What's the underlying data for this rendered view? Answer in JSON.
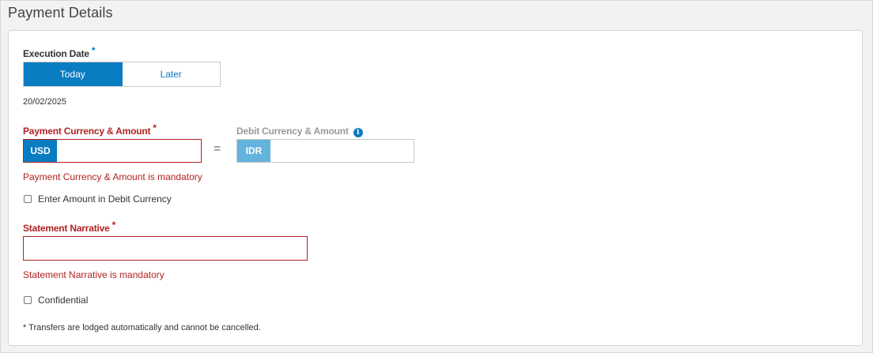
{
  "section": {
    "title": "Payment Details"
  },
  "execution_date": {
    "label": "Execution Date",
    "required_mark": "*",
    "options": [
      "Today",
      "Later"
    ],
    "selected": "Today",
    "date_value": "20/02/2025"
  },
  "payment_amount": {
    "label": "Payment Currency & Amount",
    "required_mark": "*",
    "currency": "USD",
    "value": "",
    "error": "Payment Currency & Amount is mandatory"
  },
  "equals_sign": "=",
  "debit_amount": {
    "label": "Debit Currency & Amount",
    "info_icon": "i",
    "currency": "IDR",
    "value": ""
  },
  "debit_currency_checkbox": {
    "label": "Enter Amount in Debit Currency",
    "checked": false
  },
  "statement_narrative": {
    "label": "Statement Narrative",
    "required_mark": "*",
    "value": "",
    "error": "Statement Narrative is mandatory"
  },
  "confidential_checkbox": {
    "label": "Confidential",
    "checked": false
  },
  "footnote": "* Transfers are lodged automatically and cannot be cancelled.",
  "colors": {
    "primary": "#0a7cc2",
    "primary_light": "#63b3dd",
    "error": "#b22222"
  }
}
